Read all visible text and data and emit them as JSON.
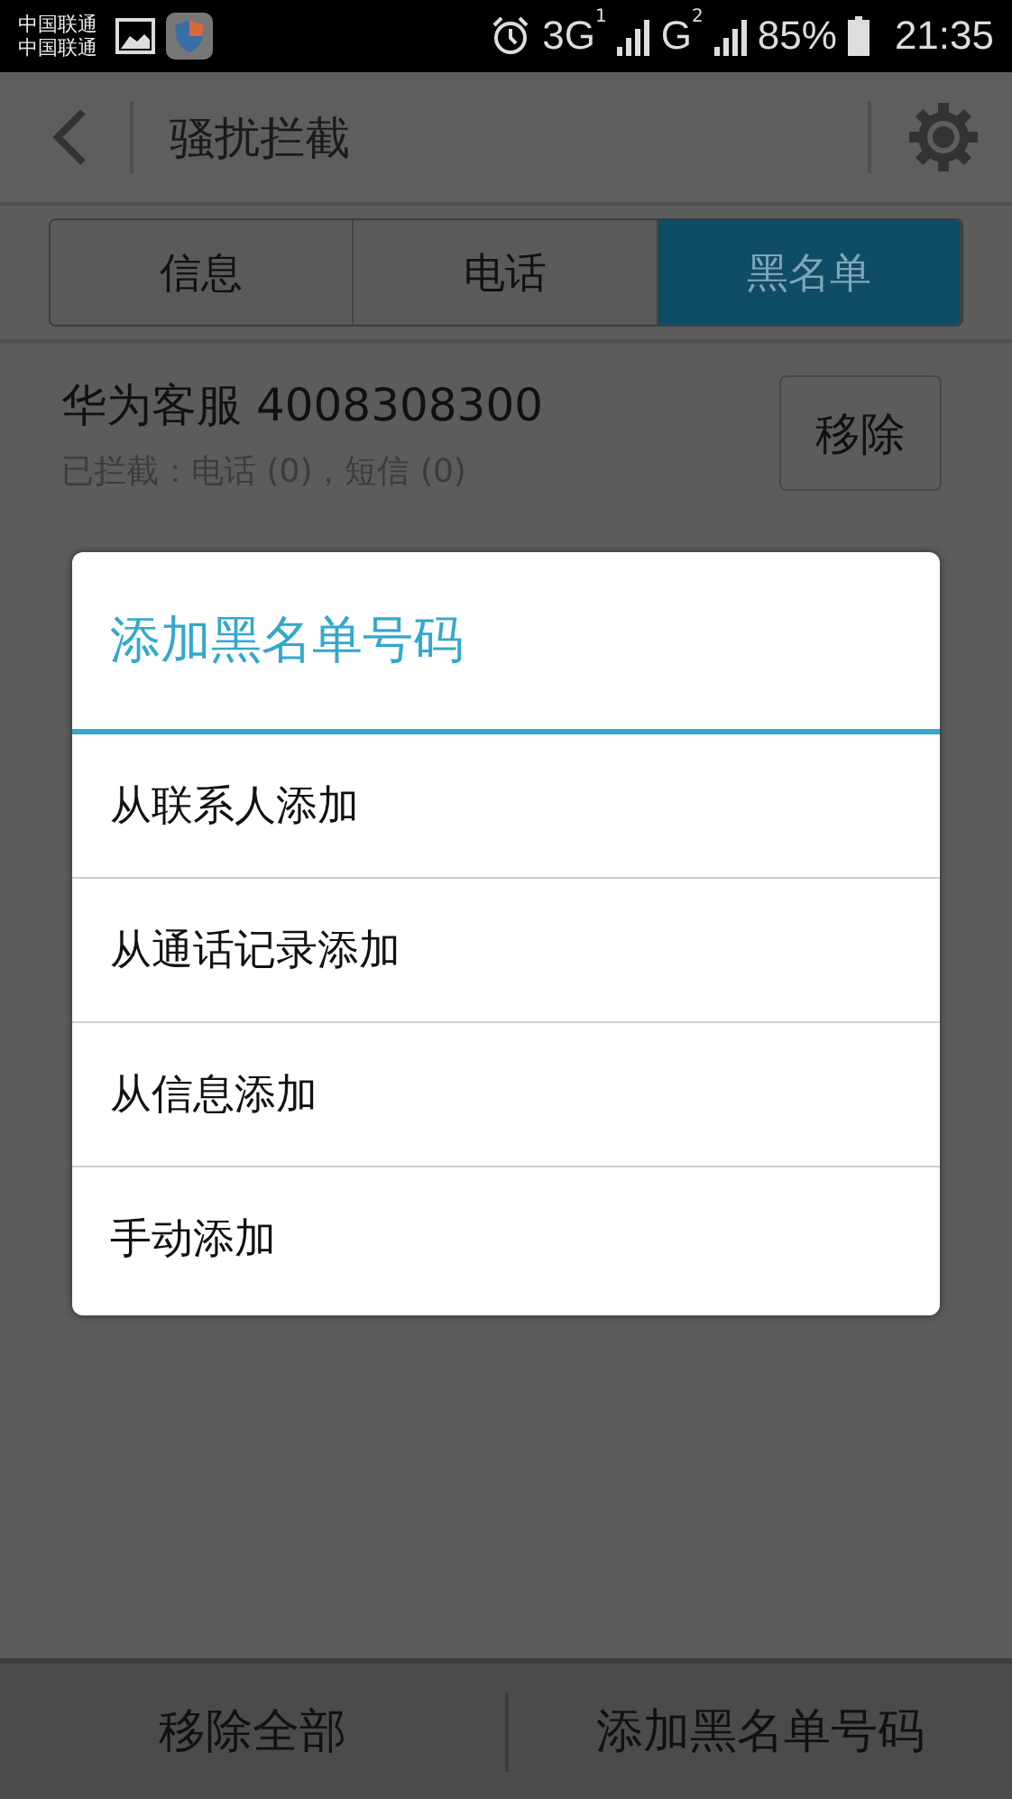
{
  "status_bar": {
    "carriers": [
      "中国联通",
      "中国联通"
    ],
    "networks": [
      {
        "label": "3G",
        "sim": "1"
      },
      {
        "label": "G",
        "sim": "2"
      }
    ],
    "battery": "85%",
    "time": "21:35"
  },
  "header": {
    "title": "骚扰拦截"
  },
  "tabs": [
    {
      "label": "信息",
      "selected": false
    },
    {
      "label": "电话",
      "selected": false
    },
    {
      "label": "黑名单",
      "selected": true
    }
  ],
  "blacklist": [
    {
      "name": "华为客服 4008308300",
      "detail": "已拦截：电话 (0)，短信 (0)",
      "button": "移除"
    }
  ],
  "dialog": {
    "title": "添加黑名单号码",
    "items": [
      "从联系人添加",
      "从通话记录添加",
      "从信息添加",
      "手动添加"
    ]
  },
  "bottom_bar": [
    "移除全部",
    "添加黑名单号码"
  ]
}
